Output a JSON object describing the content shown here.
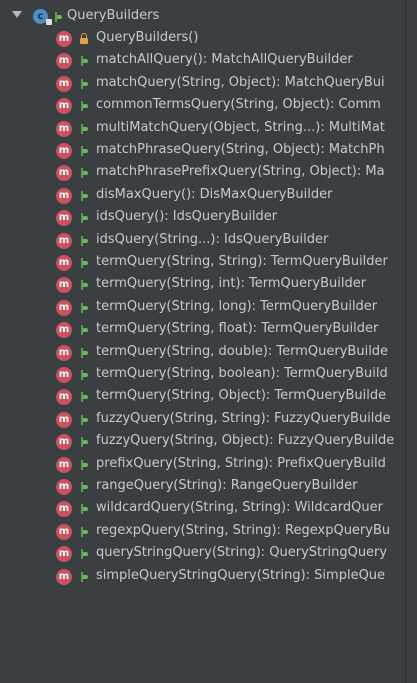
{
  "tree": {
    "root": {
      "label": "QueryBuilders",
      "icon": "class-icon",
      "expanded": true
    },
    "items": [
      {
        "label": "QueryBuilders()",
        "visibility": "private"
      },
      {
        "label": "matchAllQuery(): MatchAllQueryBuilder",
        "visibility": "public"
      },
      {
        "label": "matchQuery(String, Object): MatchQueryBui",
        "visibility": "public"
      },
      {
        "label": "commonTermsQuery(String, Object): Comm",
        "visibility": "public"
      },
      {
        "label": "multiMatchQuery(Object, String...): MultiMat",
        "visibility": "public"
      },
      {
        "label": "matchPhraseQuery(String, Object): MatchPh",
        "visibility": "public"
      },
      {
        "label": "matchPhrasePrefixQuery(String, Object): Ma",
        "visibility": "public"
      },
      {
        "label": "disMaxQuery(): DisMaxQueryBuilder",
        "visibility": "public"
      },
      {
        "label": "idsQuery(): IdsQueryBuilder",
        "visibility": "public"
      },
      {
        "label": "idsQuery(String...): IdsQueryBuilder",
        "visibility": "public"
      },
      {
        "label": "termQuery(String, String): TermQueryBuilder",
        "visibility": "public"
      },
      {
        "label": "termQuery(String, int): TermQueryBuilder",
        "visibility": "public"
      },
      {
        "label": "termQuery(String, long): TermQueryBuilder",
        "visibility": "public"
      },
      {
        "label": "termQuery(String, float): TermQueryBuilder",
        "visibility": "public"
      },
      {
        "label": "termQuery(String, double): TermQueryBuilde",
        "visibility": "public"
      },
      {
        "label": "termQuery(String, boolean): TermQueryBuild",
        "visibility": "public"
      },
      {
        "label": "termQuery(String, Object): TermQueryBuilde",
        "visibility": "public"
      },
      {
        "label": "fuzzyQuery(String, String): FuzzyQueryBuilde",
        "visibility": "public"
      },
      {
        "label": "fuzzyQuery(String, Object): FuzzyQueryBuilde",
        "visibility": "public"
      },
      {
        "label": "prefixQuery(String, String): PrefixQueryBuild",
        "visibility": "public"
      },
      {
        "label": "rangeQuery(String): RangeQueryBuilder",
        "visibility": "public"
      },
      {
        "label": "wildcardQuery(String, String): WildcardQuer",
        "visibility": "public"
      },
      {
        "label": "regexpQuery(String, String): RegexpQueryBu",
        "visibility": "public"
      },
      {
        "label": "queryStringQuery(String): QueryStringQuery",
        "visibility": "public"
      },
      {
        "label": "simpleQueryStringQuery(String): SimpleQue",
        "visibility": "public"
      }
    ],
    "method_icon_letter": "m",
    "class_icon_letter": "c"
  },
  "colors": {
    "background": "#3c3f41",
    "text": "#c9c9c9",
    "method_icon": "#c7545f",
    "class_icon": "#4a8fc7",
    "public_marker": "#5a9e54",
    "private_marker": "#e0a050"
  }
}
